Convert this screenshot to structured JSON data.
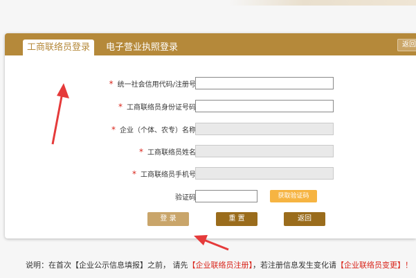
{
  "tabs": [
    {
      "label": "工商联络员登录",
      "active": true
    },
    {
      "label": "电子营业执照登录",
      "active": false
    }
  ],
  "header_back_label": "返回",
  "form": {
    "fields": [
      {
        "label": "统一社会信用代码/注册号",
        "required": true,
        "value": "",
        "disabled": false
      },
      {
        "label": "工商联络员身份证号码",
        "required": true,
        "value": "",
        "disabled": false
      },
      {
        "label": "企业（个体、农专）名称",
        "required": true,
        "value": "",
        "disabled": true
      },
      {
        "label": "工商联络员姓名",
        "required": true,
        "value": "",
        "disabled": true
      },
      {
        "label": "工商联络员手机号",
        "required": true,
        "value": "",
        "disabled": true
      }
    ],
    "captcha_label": "验证码",
    "captcha_value": "",
    "get_code_label": "获取验证码",
    "required_mark": "*"
  },
  "buttons": {
    "login": "登 录",
    "reset": "重 置",
    "back": "返回"
  },
  "note": {
    "prefix": "说明：在首次【企业公示信息填报】之前，  请先",
    "link1": "【企业联络员注册】",
    "middle": "，若注册信息发生变化请",
    "link2": "【企业联络员变更】！"
  },
  "colors": {
    "header": "#b5893a",
    "accent_red": "#d9261c",
    "code_button": "#f6b442",
    "annotation_arrow": "#e53a3a"
  },
  "annotations": {
    "arrow_icons": [
      "red-arrow-icon",
      "red-arrow-icon"
    ]
  }
}
